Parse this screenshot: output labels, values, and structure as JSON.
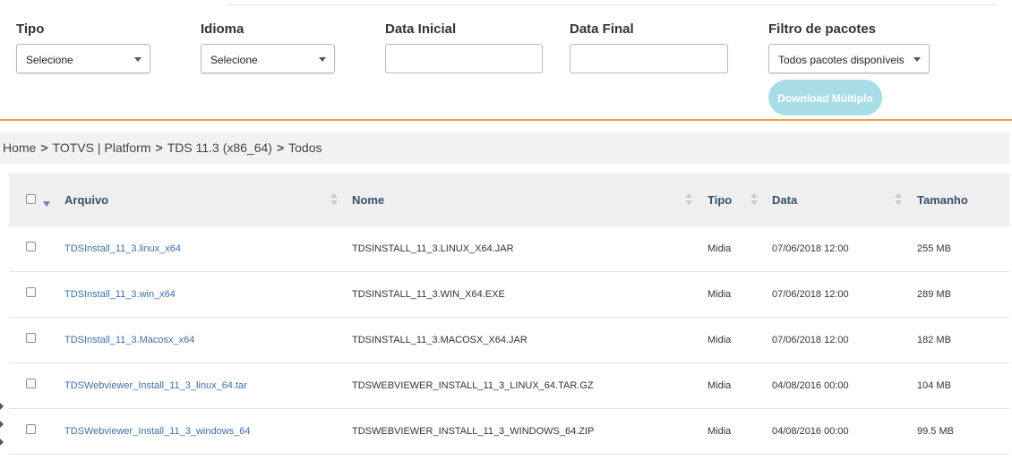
{
  "filters": {
    "tipo": {
      "label": "Tipo",
      "value": "Selecione"
    },
    "idioma": {
      "label": "Idioma",
      "value": "Selecione"
    },
    "data_inicial": {
      "label": "Data Inicial",
      "value": ""
    },
    "data_final": {
      "label": "Data Final",
      "value": ""
    },
    "filtro_pacotes": {
      "label": "Filtro de pacotes",
      "value": "Todos pacotes disponíveis"
    },
    "download_label": "Download Múltiplo"
  },
  "breadcrumb": [
    "Home",
    "TOTVS | Platform",
    "TDS 11.3 (x86_64)",
    "Todos"
  ],
  "table": {
    "headers": {
      "arquivo": "Arquivo",
      "nome": "Nome",
      "tipo": "Tipo",
      "data": "Data",
      "tamanho": "Tamanho"
    },
    "rows": [
      {
        "arquivo": "TDSInstall_11_3.linux_x64",
        "nome": "TDSINSTALL_11_3.LINUX_X64.JAR",
        "tipo": "Midia",
        "data": "07/06/2018 12:00",
        "tamanho": "255 MB"
      },
      {
        "arquivo": "TDSInstall_11_3.win_x64",
        "nome": "TDSINSTALL_11_3.WIN_X64.EXE",
        "tipo": "Midia",
        "data": "07/06/2018 12:00",
        "tamanho": "289 MB"
      },
      {
        "arquivo": "TDSInstall_11_3.Macosx_x64",
        "nome": "TDSINSTALL_11_3.MACOSX_X64.JAR",
        "tipo": "Midia",
        "data": "07/06/2018 12:00",
        "tamanho": "182 MB"
      },
      {
        "arquivo": "TDSWebviewer_Install_11_3_linux_64.tar",
        "nome": "TDSWEBVIEWER_INSTALL_11_3_LINUX_64.TAR.GZ",
        "tipo": "Midia",
        "data": "04/08/2016 00:00",
        "tamanho": "104 MB"
      },
      {
        "arquivo": "TDSWebviewer_Install_11_3_windows_64",
        "nome": "TDSWEBVIEWER_INSTALL_11_3_WINDOWS_64.ZIP",
        "tipo": "Midia",
        "data": "04/08/2016 00:00",
        "tamanho": "99.5 MB"
      }
    ]
  },
  "colors": {
    "accent_orange": "#f0a04b",
    "button_disabled": "#a8dde8",
    "link_blue": "#3d6ea8",
    "header_text": "#35506b"
  }
}
